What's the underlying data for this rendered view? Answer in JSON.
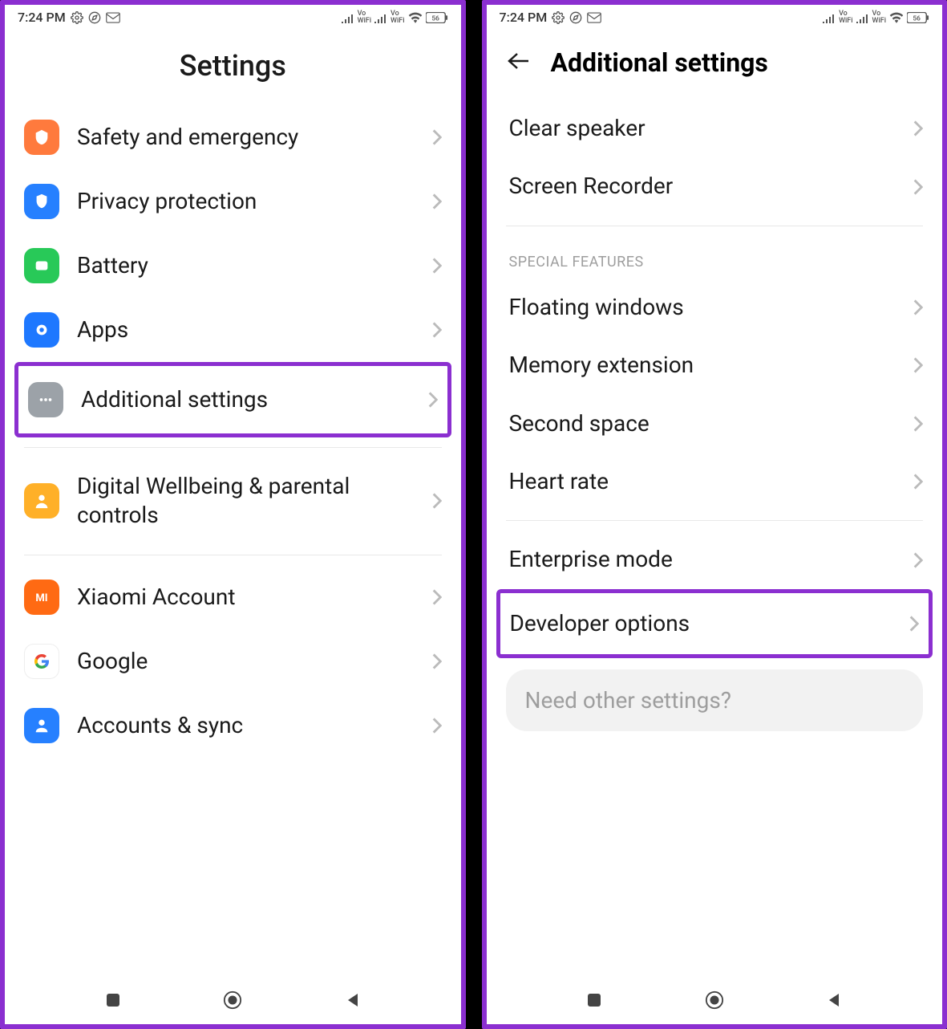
{
  "statusbar": {
    "time": "7:24 PM",
    "battery": "56"
  },
  "left": {
    "title": "Settings",
    "rows": {
      "safety": "Safety and emergency",
      "privacy": "Privacy protection",
      "battery": "Battery",
      "apps": "Apps",
      "additional": "Additional settings",
      "digital": "Digital Wellbeing & parental controls",
      "xiaomi": "Xiaomi Account",
      "google": "Google",
      "accounts": "Accounts & sync"
    }
  },
  "right": {
    "title": "Additional settings",
    "rows": {
      "clearspeaker": "Clear speaker",
      "screenrec": "Screen Recorder",
      "floating": "Floating windows",
      "memory": "Memory extension",
      "secondspace": "Second space",
      "heartrate": "Heart rate",
      "enterprise": "Enterprise mode",
      "developer": "Developer options"
    },
    "section_title": "SPECIAL FEATURES",
    "search_hint": "Need other settings?"
  }
}
